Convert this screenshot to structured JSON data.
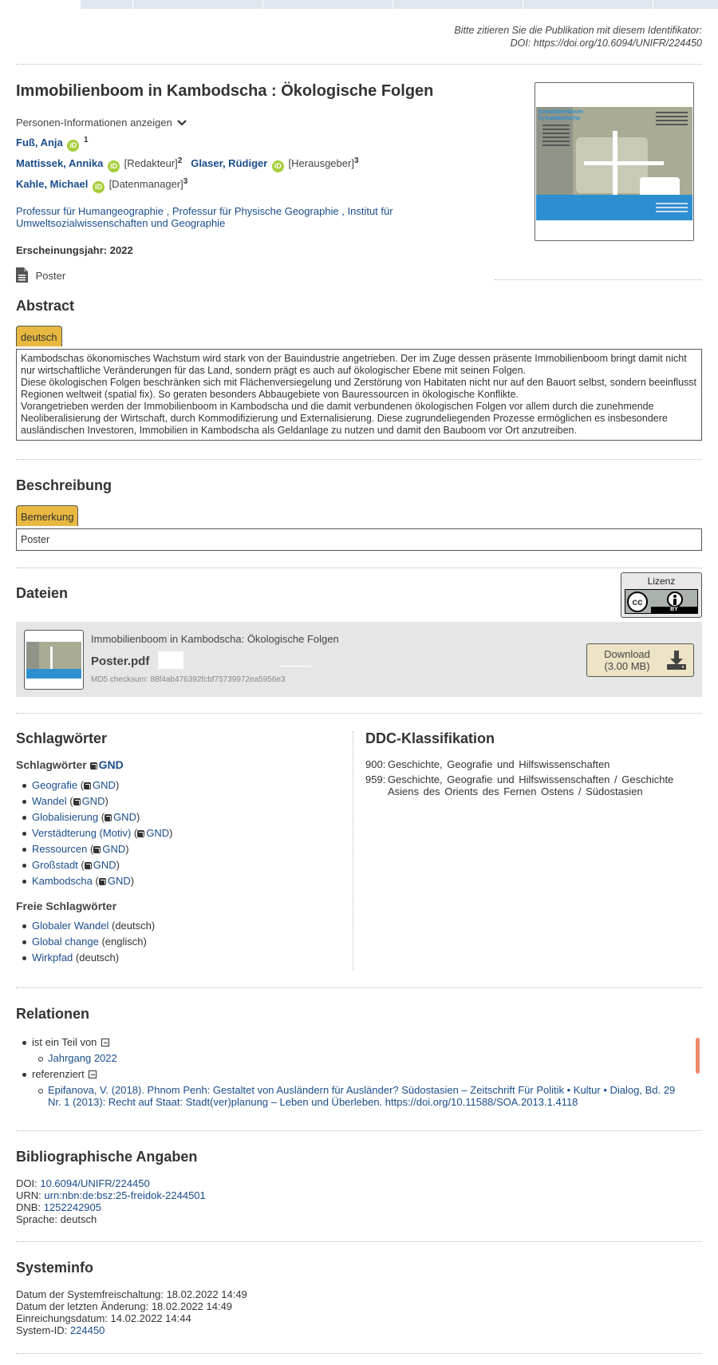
{
  "citation": {
    "line1": "Bitte zitieren Sie die Publikation mit diesem Identifikator:",
    "line2": "DOI: https://doi.org/10.6094/UNIFR/224450"
  },
  "record": {
    "title": "Immobilienboom in Kambodscha : Ökologische Folgen",
    "persons_toggle": "Personen-Informationen anzeigen",
    "authors": [
      {
        "name": "Fuß, Anja",
        "role": "",
        "sup": "1"
      },
      {
        "name": "Mattissek, Annika",
        "role": "[Redakteur]",
        "sup": "2"
      },
      {
        "name": "Glaser, Rüdiger",
        "role": "[Herausgeber]",
        "sup": "3"
      },
      {
        "name": "Kahle, Michael",
        "role": "[Datenmanager]",
        "sup": "3"
      }
    ],
    "affiliations": "Professur für Humangeographie , Professur für Physische Geographie , Institut für Umweltsozialwissenschaften und Geographie",
    "year_label": "Erscheinungsjahr: 2022",
    "type": "Poster",
    "poster_title_line1": "Immobilienboom",
    "poster_title_line2": "in Kambodscha"
  },
  "abstract": {
    "heading": "Abstract",
    "tab": "deutsch",
    "p1": "Kambodschas ökonomisches Wachstum wird stark von der Bauindustrie angetrieben. Der im Zuge dessen präsente Immobilienboom bringt damit nicht nur wirtschaftliche Veränderungen für das Land, sondern prägt es auch auf ökologischer Ebene mit seinen Folgen.",
    "p2": "Diese ökologischen Folgen beschränken sich mit Flächenversiegelung und Zerstörung von Habitaten nicht nur auf den Bauort selbst, sondern beeinflusst Regionen weltweit (spatial fix). So geraten besonders Abbaugebiete von Bauressourcen in ökologische Konflikte.",
    "p3": "Vorangetrieben werden der Immobilienboom in Kambodscha und die damit verbundenen ökologischen Folgen vor allem durch die zunehmende Neoliberalisierung der Wirtschaft, durch Kommodifizierung und Externalisierung. Diese zugrundeliegenden Prozesse ermöglichen es insbesondere ausländischen Investoren, Immobilien in Kambodscha als Geldanlage zu nutzen und damit den Bauboom vor Ort anzutreiben."
  },
  "description": {
    "heading": "Beschreibung",
    "tab": "Bemerkung",
    "text": "Poster"
  },
  "files": {
    "heading": "Dateien",
    "license_label": "Lizenz",
    "license_badge": "BY",
    "file_title": "Immobilienboom in Kambodscha: Ökologische Folgen",
    "filename": "Poster.pdf",
    "checksum": "MD5 checksum: 88f4ab476392fcbf75739972ea5956e3",
    "download_label": "Download",
    "download_size": "(3.00 MB)"
  },
  "keywords": {
    "heading": "Schlagwörter",
    "gnd_heading": "Schlagwörter",
    "gnd_label": "GND",
    "gnd_items": [
      "Geografie",
      "Wandel",
      "Globalisierung",
      "Verstädterung (Motiv)",
      "Ressourcen",
      "Großstadt",
      "Kambodscha"
    ],
    "free_heading": "Freie Schlagwörter",
    "free_items": [
      {
        "term": "Globaler Wandel",
        "lang": "(deutsch)"
      },
      {
        "term": "Global change",
        "lang": "(englisch)"
      },
      {
        "term": "Wirkpfad",
        "lang": "(deutsch)"
      }
    ]
  },
  "ddc": {
    "heading": "DDC-Klassifikation",
    "items": [
      {
        "code": "900:",
        "text": "Geschichte, Geografie und Hilfswissenschaften"
      },
      {
        "code": "959:",
        "text": "Geschichte, Geografie und Hilfswissenschaften / Geschichte Asiens des Orients des Fernen Ostens / Südostasien"
      }
    ]
  },
  "relations": {
    "heading": "Relationen",
    "part_of_label": "ist ein Teil von",
    "part_of_item": "Jahrgang 2022",
    "references_label": "referenziert",
    "references_item": "Epifanova, V. (2018). Phnom Penh: Gestaltet von Ausländern für Ausländer? Südostasien – Zeitschrift Für Politik • Kultur • Dialog, Bd. 29 Nr. 1 (2013): Recht auf Staat: Stadt(ver)planung – Leben und Überleben. https://doi.org/10.11588/SOA.2013.1.4118"
  },
  "biblio": {
    "heading": "Bibliographische Angaben",
    "doi_label": "DOI:",
    "doi": "10.6094/UNIFR/224450",
    "urn_label": "URN:",
    "urn": "urn:nbn:de:bsz:25-freidok-2244501",
    "dnb_label": "DNB:",
    "dnb": "1252242905",
    "language": "Sprache: deutsch"
  },
  "sysinfo": {
    "heading": "Systeminfo",
    "published": "Datum der Systemfreischaltung: 18.02.2022 14:49",
    "modified": "Datum der letzten Änderung: 18.02.2022 14:49",
    "submitted": "Einreichungsdatum: 14.02.2022 14:44",
    "sysid_label": "System-ID:",
    "sysid": "224450"
  },
  "colors": {
    "link": "#1a4d8c",
    "tab": "#e8b840",
    "orcid": "#a6ce39",
    "poster_blue": "#2d8fd0"
  }
}
